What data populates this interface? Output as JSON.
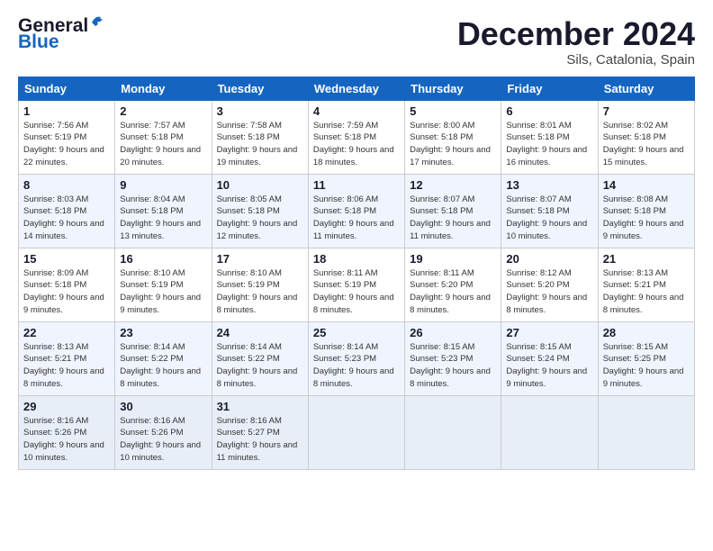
{
  "header": {
    "logo_general": "General",
    "logo_blue": "Blue",
    "month_title": "December 2024",
    "location": "Sils, Catalonia, Spain"
  },
  "weekdays": [
    "Sunday",
    "Monday",
    "Tuesday",
    "Wednesday",
    "Thursday",
    "Friday",
    "Saturday"
  ],
  "weeks": [
    [
      {
        "day": "1",
        "sunrise": "7:56 AM",
        "sunset": "5:19 PM",
        "daylight": "9 hours and 22 minutes."
      },
      {
        "day": "2",
        "sunrise": "7:57 AM",
        "sunset": "5:18 PM",
        "daylight": "9 hours and 20 minutes."
      },
      {
        "day": "3",
        "sunrise": "7:58 AM",
        "sunset": "5:18 PM",
        "daylight": "9 hours and 19 minutes."
      },
      {
        "day": "4",
        "sunrise": "7:59 AM",
        "sunset": "5:18 PM",
        "daylight": "9 hours and 18 minutes."
      },
      {
        "day": "5",
        "sunrise": "8:00 AM",
        "sunset": "5:18 PM",
        "daylight": "9 hours and 17 minutes."
      },
      {
        "day": "6",
        "sunrise": "8:01 AM",
        "sunset": "5:18 PM",
        "daylight": "9 hours and 16 minutes."
      },
      {
        "day": "7",
        "sunrise": "8:02 AM",
        "sunset": "5:18 PM",
        "daylight": "9 hours and 15 minutes."
      }
    ],
    [
      {
        "day": "8",
        "sunrise": "8:03 AM",
        "sunset": "5:18 PM",
        "daylight": "9 hours and 14 minutes."
      },
      {
        "day": "9",
        "sunrise": "8:04 AM",
        "sunset": "5:18 PM",
        "daylight": "9 hours and 13 minutes."
      },
      {
        "day": "10",
        "sunrise": "8:05 AM",
        "sunset": "5:18 PM",
        "daylight": "9 hours and 12 minutes."
      },
      {
        "day": "11",
        "sunrise": "8:06 AM",
        "sunset": "5:18 PM",
        "daylight": "9 hours and 11 minutes."
      },
      {
        "day": "12",
        "sunrise": "8:07 AM",
        "sunset": "5:18 PM",
        "daylight": "9 hours and 11 minutes."
      },
      {
        "day": "13",
        "sunrise": "8:07 AM",
        "sunset": "5:18 PM",
        "daylight": "9 hours and 10 minutes."
      },
      {
        "day": "14",
        "sunrise": "8:08 AM",
        "sunset": "5:18 PM",
        "daylight": "9 hours and 9 minutes."
      }
    ],
    [
      {
        "day": "15",
        "sunrise": "8:09 AM",
        "sunset": "5:18 PM",
        "daylight": "9 hours and 9 minutes."
      },
      {
        "day": "16",
        "sunrise": "8:10 AM",
        "sunset": "5:19 PM",
        "daylight": "9 hours and 9 minutes."
      },
      {
        "day": "17",
        "sunrise": "8:10 AM",
        "sunset": "5:19 PM",
        "daylight": "9 hours and 8 minutes."
      },
      {
        "day": "18",
        "sunrise": "8:11 AM",
        "sunset": "5:19 PM",
        "daylight": "9 hours and 8 minutes."
      },
      {
        "day": "19",
        "sunrise": "8:11 AM",
        "sunset": "5:20 PM",
        "daylight": "9 hours and 8 minutes."
      },
      {
        "day": "20",
        "sunrise": "8:12 AM",
        "sunset": "5:20 PM",
        "daylight": "9 hours and 8 minutes."
      },
      {
        "day": "21",
        "sunrise": "8:13 AM",
        "sunset": "5:21 PM",
        "daylight": "9 hours and 8 minutes."
      }
    ],
    [
      {
        "day": "22",
        "sunrise": "8:13 AM",
        "sunset": "5:21 PM",
        "daylight": "9 hours and 8 minutes."
      },
      {
        "day": "23",
        "sunrise": "8:14 AM",
        "sunset": "5:22 PM",
        "daylight": "9 hours and 8 minutes."
      },
      {
        "day": "24",
        "sunrise": "8:14 AM",
        "sunset": "5:22 PM",
        "daylight": "9 hours and 8 minutes."
      },
      {
        "day": "25",
        "sunrise": "8:14 AM",
        "sunset": "5:23 PM",
        "daylight": "9 hours and 8 minutes."
      },
      {
        "day": "26",
        "sunrise": "8:15 AM",
        "sunset": "5:23 PM",
        "daylight": "9 hours and 8 minutes."
      },
      {
        "day": "27",
        "sunrise": "8:15 AM",
        "sunset": "5:24 PM",
        "daylight": "9 hours and 9 minutes."
      },
      {
        "day": "28",
        "sunrise": "8:15 AM",
        "sunset": "5:25 PM",
        "daylight": "9 hours and 9 minutes."
      }
    ],
    [
      {
        "day": "29",
        "sunrise": "8:16 AM",
        "sunset": "5:26 PM",
        "daylight": "9 hours and 10 minutes."
      },
      {
        "day": "30",
        "sunrise": "8:16 AM",
        "sunset": "5:26 PM",
        "daylight": "9 hours and 10 minutes."
      },
      {
        "day": "31",
        "sunrise": "8:16 AM",
        "sunset": "5:27 PM",
        "daylight": "9 hours and 11 minutes."
      },
      null,
      null,
      null,
      null
    ]
  ]
}
